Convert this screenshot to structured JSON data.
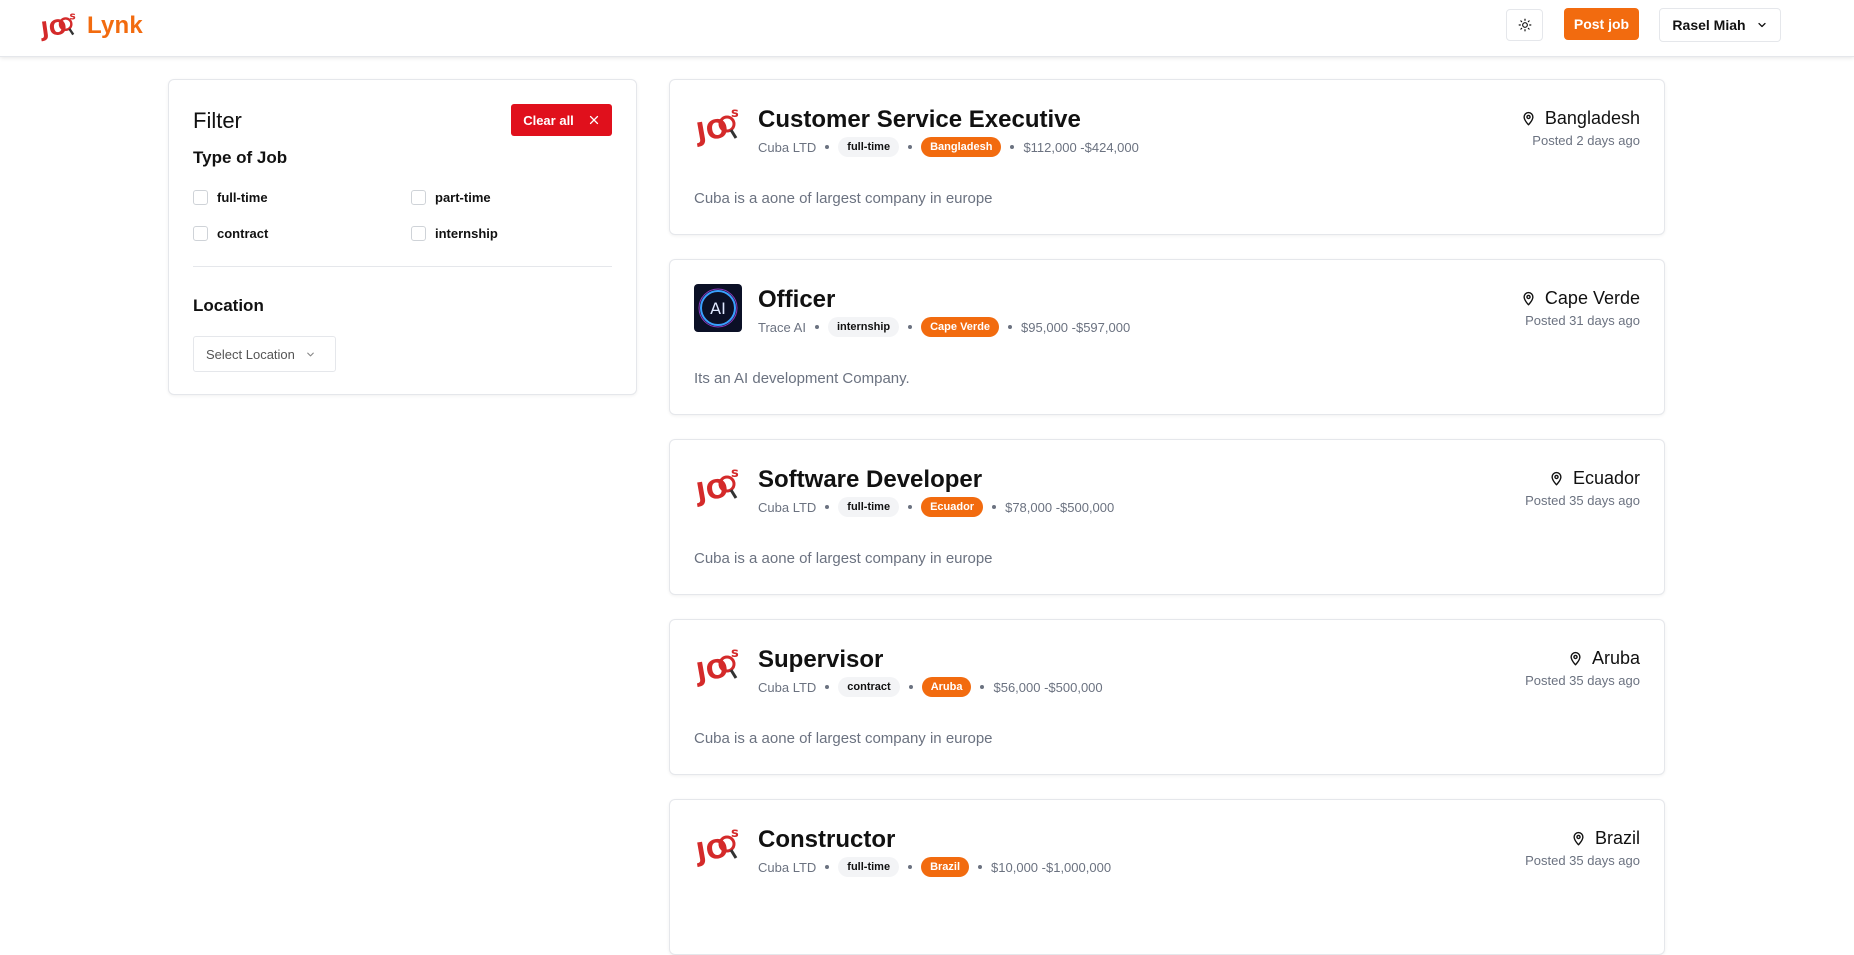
{
  "header": {
    "brand": "Lynk",
    "post_job_label": "Post job",
    "user_name": "Rasel Miah",
    "colors": {
      "accent": "#f26b0f",
      "danger": "#e0101c"
    }
  },
  "filter": {
    "title": "Filter",
    "clear_label": "Clear all",
    "type_title": "Type of Job",
    "types": [
      "full-time",
      "part-time",
      "contract",
      "internship"
    ],
    "location_title": "Location",
    "location_placeholder": "Select Location"
  },
  "jobs": [
    {
      "title": "Customer Service Executive",
      "company": "Cuba LTD",
      "type": "full-time",
      "location_tag": "Bangladesh",
      "salary": "$112,000 -$424,000",
      "description": "Cuba is a aone of largest company in europe",
      "location": "Bangladesh",
      "posted": "Posted 2 days ago",
      "logo": "jobs-logo-icon"
    },
    {
      "title": "Officer",
      "company": "Trace AI",
      "type": "internship",
      "location_tag": "Cape Verde",
      "salary": "$95,000 -$597,000",
      "description": "Its an AI development Company.",
      "location": "Cape Verde",
      "posted": "Posted 31 days ago",
      "logo": "ai-logo-icon"
    },
    {
      "title": "Software Developer",
      "company": "Cuba LTD",
      "type": "full-time",
      "location_tag": "Ecuador",
      "salary": "$78,000 -$500,000",
      "description": "Cuba is a aone of largest company in europe",
      "location": "Ecuador",
      "posted": "Posted 35 days ago",
      "logo": "jobs-logo-icon"
    },
    {
      "title": "Supervisor",
      "company": "Cuba LTD",
      "type": "contract",
      "location_tag": "Aruba",
      "salary": "$56,000 -$500,000",
      "description": "Cuba is a aone of largest company in europe",
      "location": "Aruba",
      "posted": "Posted 35 days ago",
      "logo": "jobs-logo-icon"
    },
    {
      "title": "Constructor",
      "company": "Cuba LTD",
      "type": "full-time",
      "location_tag": "Brazil",
      "salary": "$10,000 -$1,000,000",
      "description": "",
      "location": "Brazil",
      "posted": "Posted 35 days ago",
      "logo": "jobs-logo-icon"
    }
  ]
}
